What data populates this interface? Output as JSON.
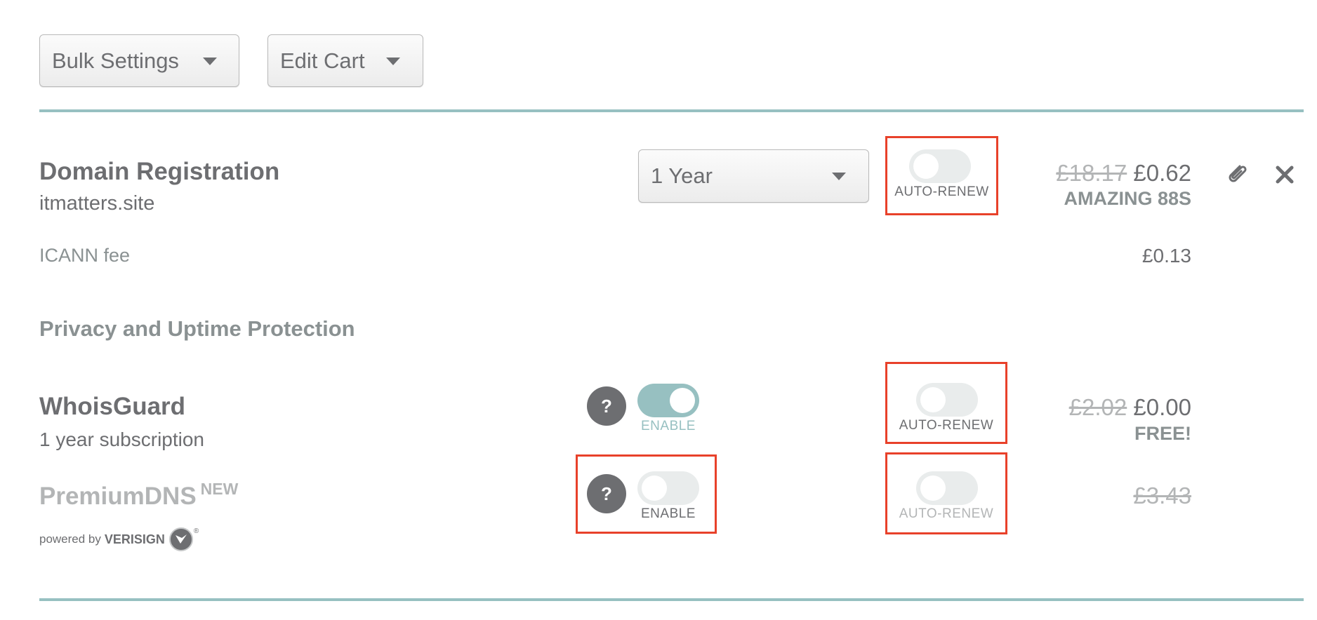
{
  "toolbar": {
    "bulk_settings_label": "Bulk Settings",
    "edit_cart_label": "Edit Cart"
  },
  "colors": {
    "accent_teal": "#97c0c1",
    "text_gray": "#6d6e71",
    "highlight_red": "#e8412a"
  },
  "domain_registration": {
    "title": "Domain Registration",
    "domain": "itmatters.site",
    "term_select": {
      "selected": "1 Year"
    },
    "auto_renew": {
      "label": "AUTO-RENEW",
      "enabled": false
    },
    "original_price": "£18.17",
    "price": "£0.62",
    "promo": "AMAZING 88S",
    "icann_fee_label": "ICANN fee",
    "icann_fee": "£0.13"
  },
  "privacy_section": {
    "heading": "Privacy and Uptime Protection",
    "whoisguard": {
      "title": "WhoisGuard",
      "subtitle": "1 year subscription",
      "help_label": "?",
      "enable": {
        "label": "ENABLE",
        "enabled": true
      },
      "auto_renew": {
        "label": "AUTO-RENEW",
        "enabled": false
      },
      "original_price": "£2.02",
      "price": "£0.00",
      "promo": "FREE!"
    },
    "premiumdns": {
      "title": "PremiumDNS",
      "badge": "NEW",
      "powered_by": "powered by",
      "brand": "VERISIGN",
      "help_label": "?",
      "enable": {
        "label": "ENABLE",
        "enabled": false
      },
      "auto_renew": {
        "label": "AUTO-RENEW",
        "enabled": false
      },
      "original_price": "£3.43"
    }
  }
}
